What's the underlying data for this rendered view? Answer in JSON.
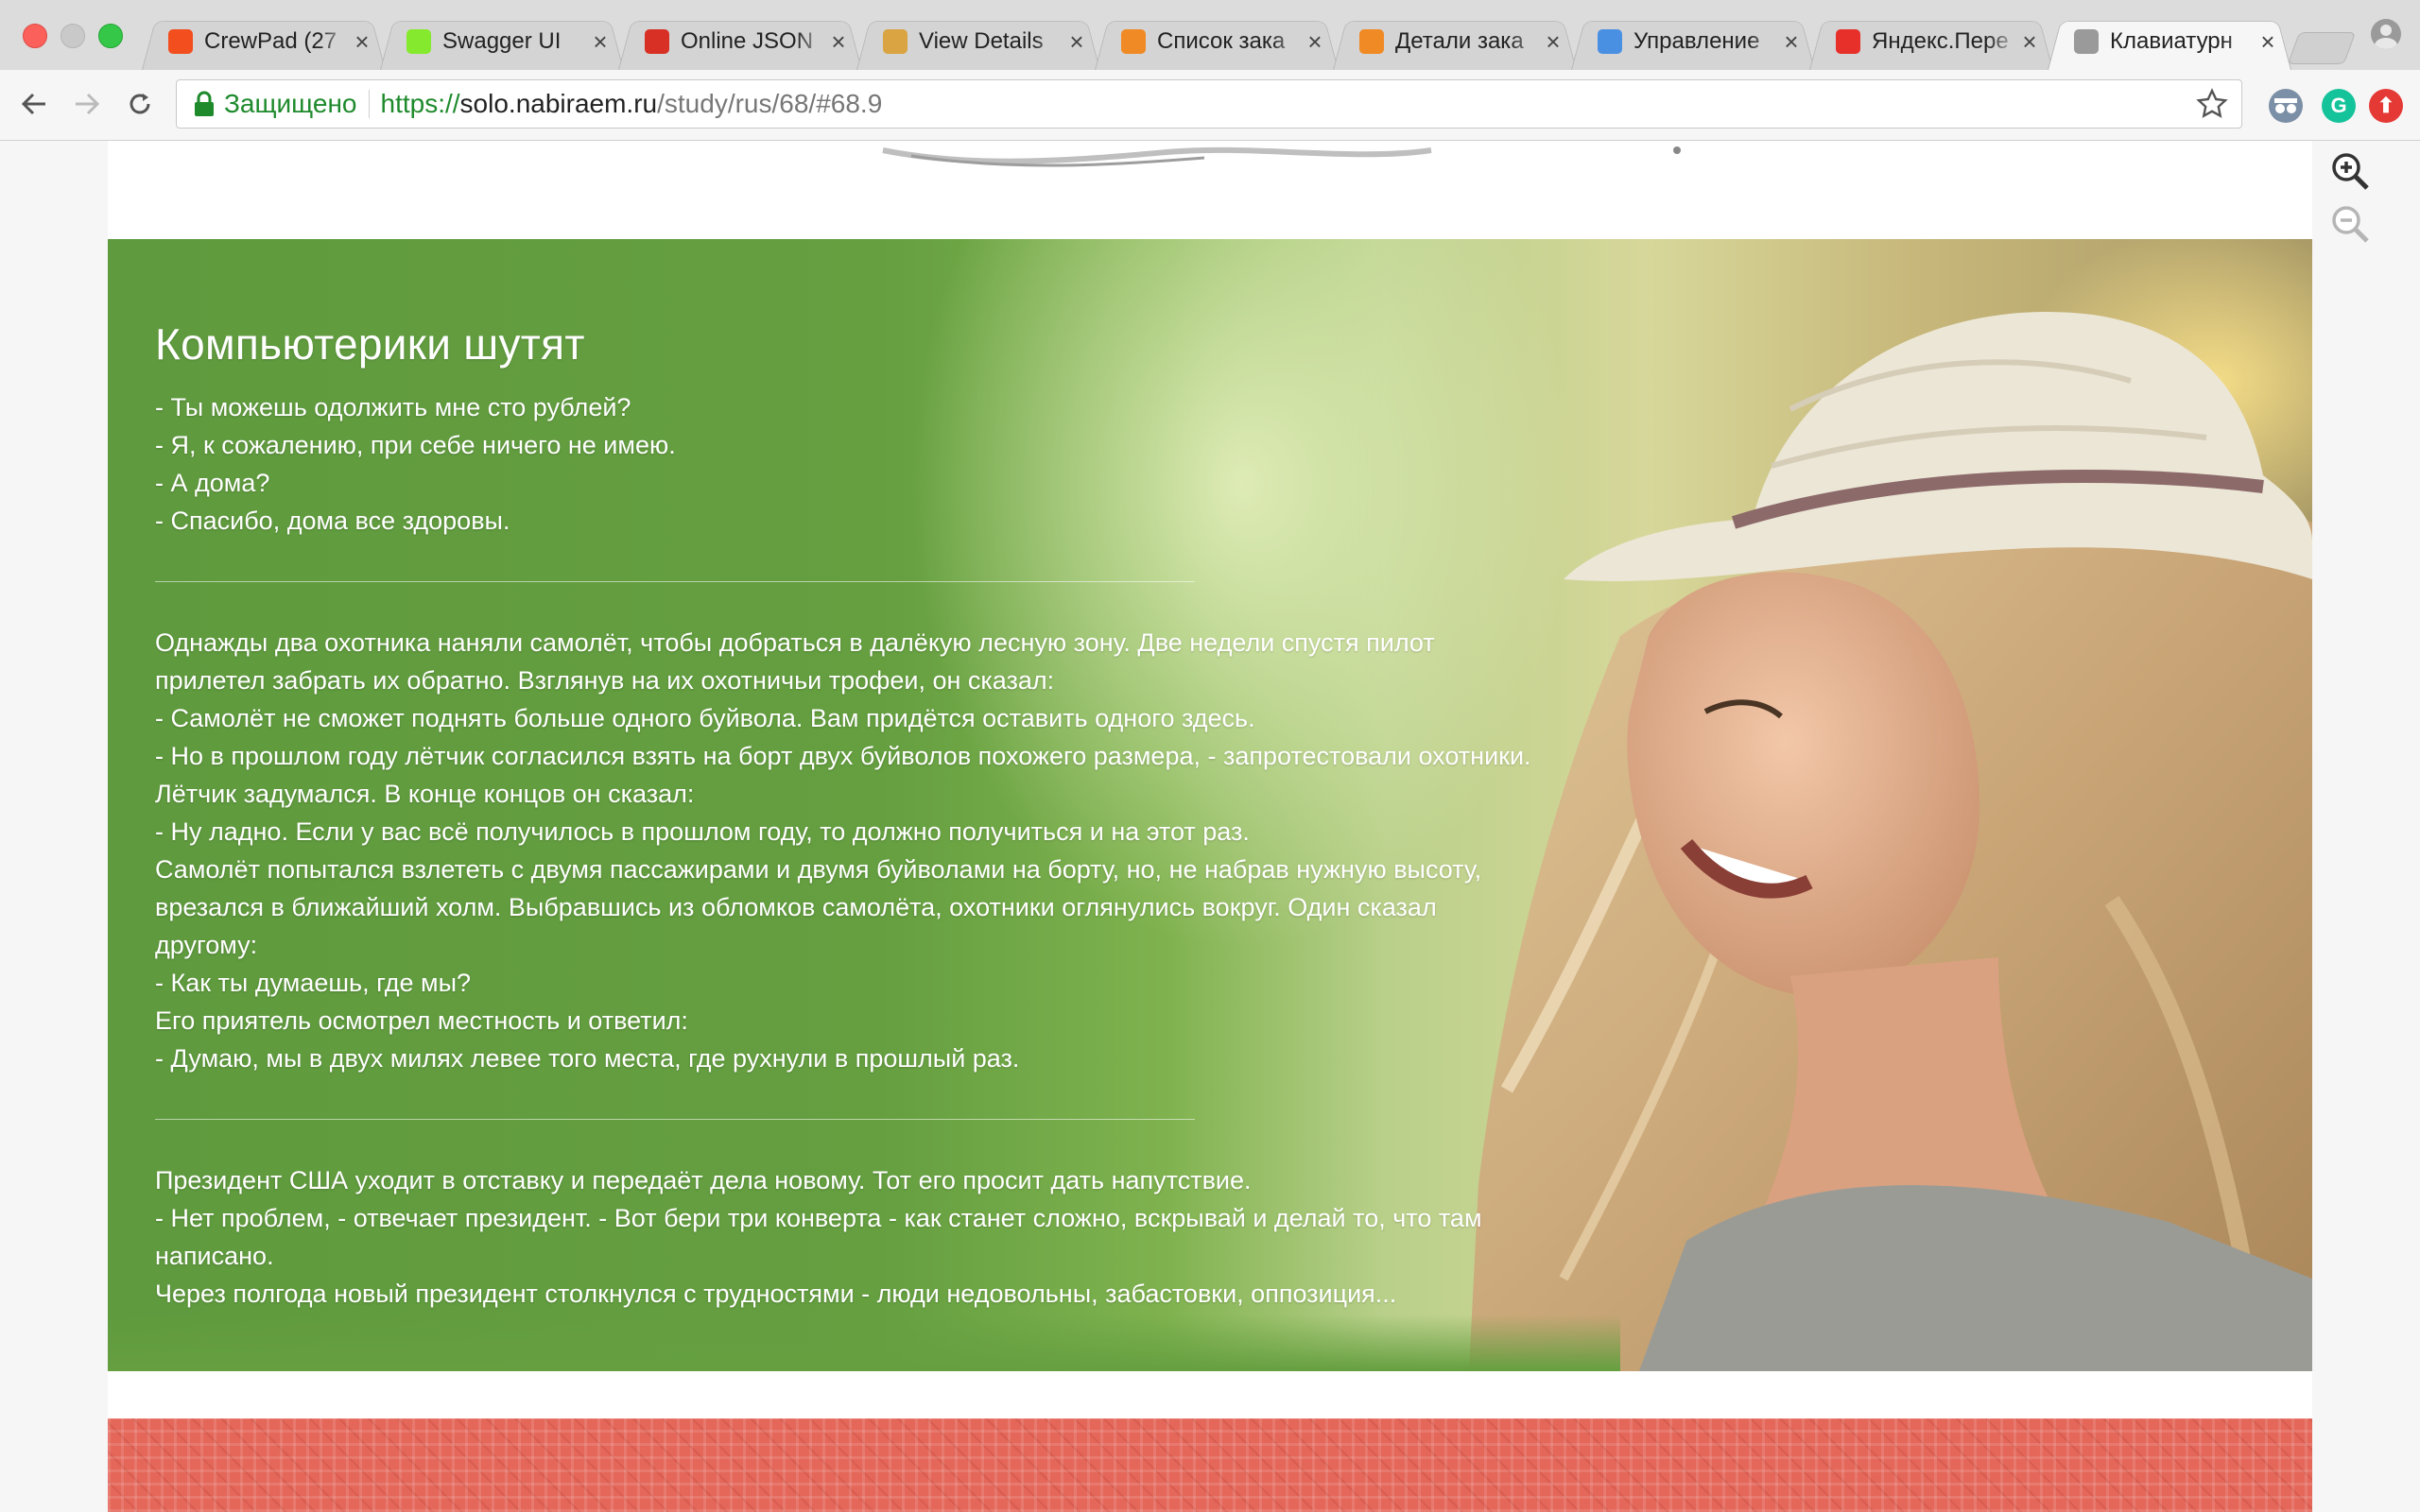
{
  "browser": {
    "tabs": [
      {
        "title": "CrewPad (27",
        "favicon": "figma-icon",
        "color": "#f24e1e",
        "active": false
      },
      {
        "title": "Swagger UI",
        "favicon": "swagger-icon",
        "color": "#85ea2d",
        "active": false
      },
      {
        "title": "Online JSON",
        "favicon": "json-viewer-icon",
        "color": "#d93025",
        "active": false
      },
      {
        "title": "View Details",
        "favicon": "pizza-slice-icon",
        "color": "#d9a441",
        "active": false
      },
      {
        "title": "Список зака",
        "favicon": "food-icon",
        "color": "#f08a24",
        "active": false
      },
      {
        "title": "Детали зака",
        "favicon": "food-icon",
        "color": "#f08a24",
        "active": false
      },
      {
        "title": "Управление",
        "favicon": "globe-icon",
        "color": "#4a90e2",
        "active": false
      },
      {
        "title": "Яндекс.Пере",
        "favicon": "yandex-translate-icon",
        "color": "#e8302a",
        "active": false
      },
      {
        "title": "Клавиатурн",
        "favicon": "page-icon",
        "color": "#9a9a9a",
        "active": true
      }
    ],
    "address": {
      "secure_label": "Защищено",
      "scheme": "https://",
      "host": "solo.nabiraem.ru",
      "path": "/study/rus/68/#68.9"
    },
    "extensions": [
      {
        "name": "incognito-extension-icon",
        "color": "#7b8fa6"
      },
      {
        "name": "grammarly-icon",
        "color": "#15c39a",
        "glyph": "G"
      },
      {
        "name": "upload-extension-icon",
        "color": "#e53935",
        "glyph": "⬆"
      }
    ]
  },
  "page": {
    "title": "Компьютерики шутят",
    "blocks": [
      [
        "- Ты можешь одолжить мне сто рублей?",
        "- Я, к сожалению, при себе ничего не имею.",
        "- А дома?",
        "- Спасибо, дома все здоровы."
      ],
      [
        "Однажды два охотника наняли самолёт, чтобы добраться в далёкую лесную зону. Две недели спустя пилот прилетел забрать их обратно. Взглянув на их охотничьи трофеи, он сказал:",
        "- Самолёт не сможет поднять больше одного буйвола. Вам придётся оставить одного здесь.",
        "- Но в прошлом году лётчик согласился взять на борт двух буйволов похожего размера, - запротестовали охотники.",
        "Лётчик задумался. В конце концов он сказал:",
        "- Ну ладно. Если у вас всё получилось в прошлом году, то должно получиться и на этот раз.",
        "Самолёт попытался взлететь с двумя пассажирами и двумя буйволами на борту, но, не набрав нужную высоту, врезался в ближайший холм. Выбравшись из обломков самолёта, охотники оглянулись вокруг. Один сказал другому:",
        "- Как ты думаешь, где мы?",
        "Его приятель осмотрел местность и ответил:",
        "- Думаю, мы в двух милях левее того места, где рухнули в прошлый раз."
      ],
      [
        "Президент США уходит в отставку и передаёт дела новому. Тот его просит дать напутствие.",
        "- Нет проблем, - отвечает президент. - Вот бери три конверта - как станет сложно, вскрывай и делай то, что там написано.",
        "Через полгода новый президент столкнулся с трудностями - люди недовольны, забастовки, оппозиция..."
      ]
    ],
    "colors": {
      "hero_green": "#659f40",
      "banner_red": "#e4675a",
      "text": "#ffffff"
    }
  }
}
